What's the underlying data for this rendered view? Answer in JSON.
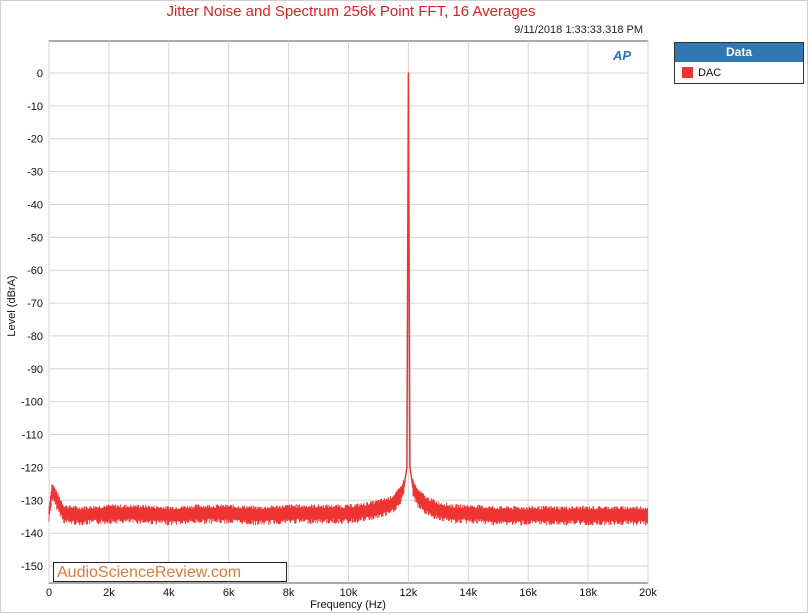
{
  "chart_data": {
    "type": "line",
    "title": "Jitter Noise and Spectrum 256k Point FFT, 16 Averages",
    "timestamp": "9/11/2018 1:33:33.318 PM",
    "xlabel": "Frequency (Hz)",
    "ylabel": "Level (dBrA)",
    "xlim": [
      0,
      20000
    ],
    "ylim": [
      -150,
      0
    ],
    "x_ticks": [
      0,
      2000,
      4000,
      6000,
      8000,
      10000,
      12000,
      14000,
      16000,
      18000,
      20000
    ],
    "x_tick_labels": [
      "0",
      "2k",
      "4k",
      "6k",
      "8k",
      "10k",
      "12k",
      "14k",
      "16k",
      "18k",
      "20k"
    ],
    "y_ticks": [
      0,
      -10,
      -20,
      -30,
      -40,
      -50,
      -60,
      -70,
      -80,
      -90,
      -100,
      -110,
      -120,
      -130,
      -140,
      -150
    ],
    "y_tick_labels": [
      "0",
      "-10",
      "-20",
      "-30",
      "-40",
      "-50",
      "-60",
      "-70",
      "-80",
      "-90",
      "-100",
      "-110",
      "-120",
      "-130",
      "-140",
      "-150"
    ],
    "grid": true,
    "legend_position": "right",
    "series": [
      {
        "name": "DAC",
        "color": "#ee3333",
        "x": [
          0,
          100,
          500,
          1000,
          2000,
          3000,
          4000,
          5000,
          6000,
          7000,
          8000,
          9000,
          10000,
          10500,
          11000,
          11400,
          11700,
          11850,
          11950,
          12000,
          12050,
          12150,
          12300,
          12600,
          13000,
          13500,
          14000,
          15000,
          16000,
          17000,
          18000,
          19000,
          20000
        ],
        "values": [
          -134,
          -127,
          -134,
          -134.5,
          -134,
          -134,
          -134.5,
          -134,
          -134,
          -134.5,
          -134,
          -134,
          -134,
          -133.5,
          -132.5,
          -131.5,
          -129,
          -126,
          -120,
          0,
          -120,
          -126,
          -129,
          -131.5,
          -133,
          -134,
          -134,
          -134.5,
          -134.5,
          -134.5,
          -134.5,
          -134.5,
          -134.5
        ]
      }
    ]
  },
  "legend": {
    "header": "Data",
    "entry": "DAC"
  },
  "logo": {
    "text": "AP"
  },
  "watermark": "AudioScienceReview.com"
}
